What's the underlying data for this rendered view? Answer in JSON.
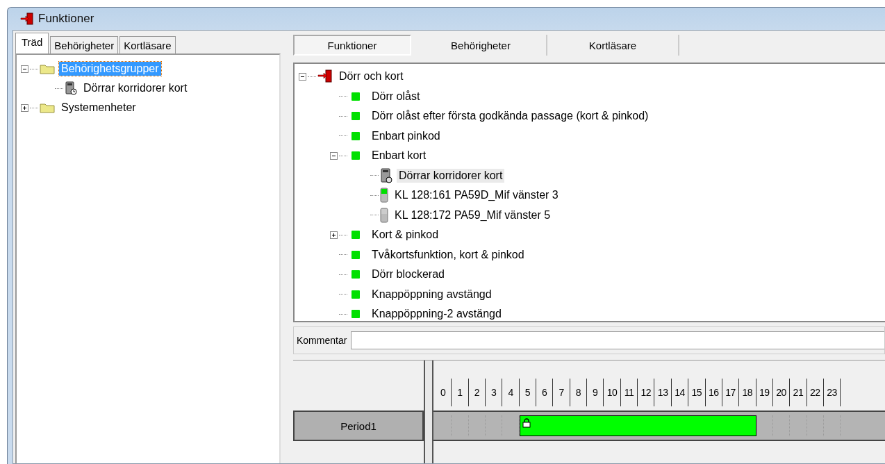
{
  "window": {
    "title": "Funktioner"
  },
  "left_tabs": [
    {
      "label": "Träd",
      "selected": true
    },
    {
      "label": "Behörigheter",
      "selected": false
    },
    {
      "label": "Kortläsare",
      "selected": false
    }
  ],
  "left_tree": {
    "items": [
      {
        "label": "Behörighetsgrupper",
        "kind": "folder",
        "expanded": true,
        "selected": true,
        "children": [
          {
            "label": "Dörrar korridorer kort",
            "kind": "keypad",
            "selected": false
          }
        ]
      },
      {
        "label": "Systemenheter",
        "kind": "folder",
        "expanded": false,
        "selected": false
      }
    ]
  },
  "right_tabs": [
    {
      "label": "Funktioner",
      "selected": true
    },
    {
      "label": "Behörigheter",
      "selected": false
    },
    {
      "label": "Kortläsare",
      "selected": false
    }
  ],
  "right_tree": {
    "items": [
      {
        "label": "Dörr och kort",
        "kind": "door",
        "expanded": true,
        "selected": false,
        "children": [
          {
            "label": "Dörr olåst",
            "kind": "status",
            "selected": false
          },
          {
            "label": "Dörr olåst efter första godkända passage (kort & pinkod)",
            "kind": "status",
            "selected": false
          },
          {
            "label": "Enbart pinkod",
            "kind": "status",
            "selected": false
          },
          {
            "label": "Enbart kort",
            "kind": "status",
            "expanded": true,
            "selected": false,
            "children": [
              {
                "label": "Dörrar korridorer kort",
                "kind": "keypad",
                "selected": true
              },
              {
                "label": "KL 128:161 PA59D_Mif vänster 3",
                "kind": "reader-on",
                "selected": false
              },
              {
                "label": "KL 128:172 PA59_Mif vänster 5",
                "kind": "reader-off",
                "selected": false
              }
            ]
          },
          {
            "label": "Kort & pinkod",
            "kind": "status",
            "expanded": false,
            "selected": false
          },
          {
            "label": "Tvåkortsfunktion, kort & pinkod",
            "kind": "status",
            "selected": false
          },
          {
            "label": "Dörr blockerad",
            "kind": "status",
            "selected": false
          },
          {
            "label": "Knappöppning avstängd",
            "kind": "status",
            "selected": false
          },
          {
            "label": "Knappöppning-2 avstängd",
            "kind": "status",
            "selected": false
          }
        ]
      }
    ]
  },
  "comment": {
    "label": "Kommentar"
  },
  "schedule": {
    "hours": [
      "0",
      "1",
      "2",
      "3",
      "4",
      "5",
      "6",
      "7",
      "8",
      "9",
      "10",
      "11",
      "12",
      "13",
      "14",
      "15",
      "16",
      "17",
      "18",
      "19",
      "20",
      "21",
      "22",
      "23"
    ],
    "periods": [
      {
        "name": "Period1",
        "locked": true,
        "on": [
          false,
          false,
          false,
          false,
          false,
          true,
          true,
          true,
          true,
          true,
          true,
          true,
          true,
          true,
          true,
          true,
          true,
          true,
          true,
          false,
          false,
          false,
          false,
          false
        ]
      }
    ]
  }
}
